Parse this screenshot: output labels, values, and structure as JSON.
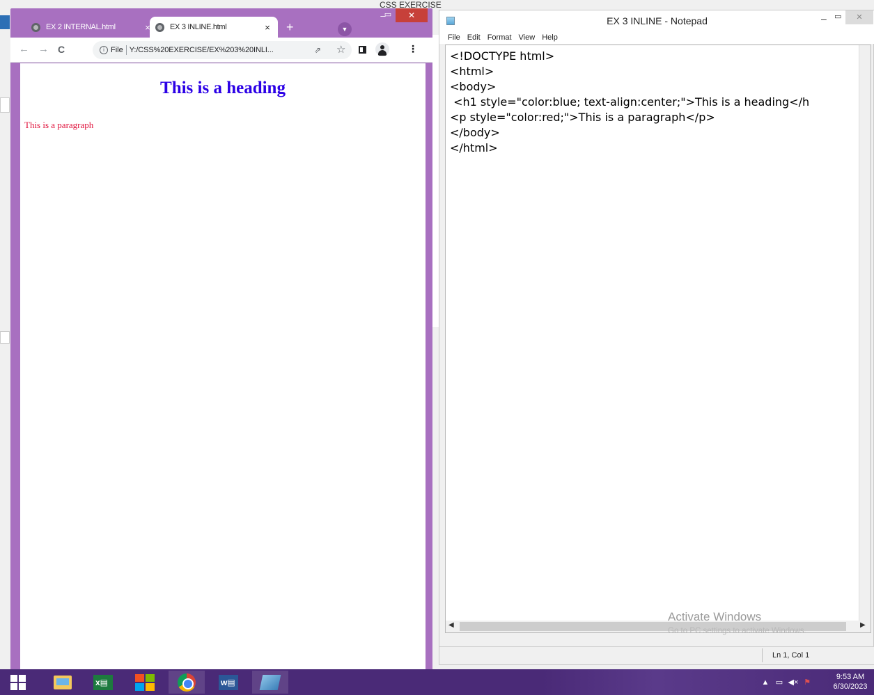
{
  "background": {
    "window_title": "CSS EXERCISE"
  },
  "browser": {
    "tabs": [
      {
        "label": "EX 2 INTERNAL.html",
        "active": false
      },
      {
        "label": "EX 3 INLINE.html",
        "active": true
      }
    ],
    "new_tab_label": "+",
    "close_label": "×",
    "toolbar": {
      "back": "←",
      "forward": "→",
      "reload": "C",
      "file_label": "File",
      "url": "Y:/CSS%20EXERCISE/EX%203%20INLI..."
    },
    "page": {
      "heading": "This is a heading",
      "paragraph": "This is a paragraph",
      "heading_color": "#2b00e6",
      "paragraph_color": "#e0103a"
    },
    "accent_color": "#a870c0"
  },
  "notepad": {
    "title": "EX 3 INLINE - Notepad",
    "menu": [
      "File",
      "Edit",
      "Format",
      "View",
      "Help"
    ],
    "content": "<!DOCTYPE html>\n<html>\n<body>\n <h1 style=\"color:blue; text-align:center;\">This is a heading</h\n<p style=\"color:red;\">This is a paragraph</p>\n</body>\n</html>",
    "status_position": "Ln 1, Col 1",
    "watermark_title": "Activate Windows",
    "watermark_sub": "Go to PC settings to activate Windows."
  },
  "taskbar": {
    "apps": [
      "start-icon",
      "file-explorer-icon",
      "excel-icon",
      "store-icon",
      "chrome-icon",
      "word-icon",
      "other-app-icon"
    ],
    "time": "9:53 AM",
    "date": "6/30/2023",
    "color": "#4a2a77"
  }
}
